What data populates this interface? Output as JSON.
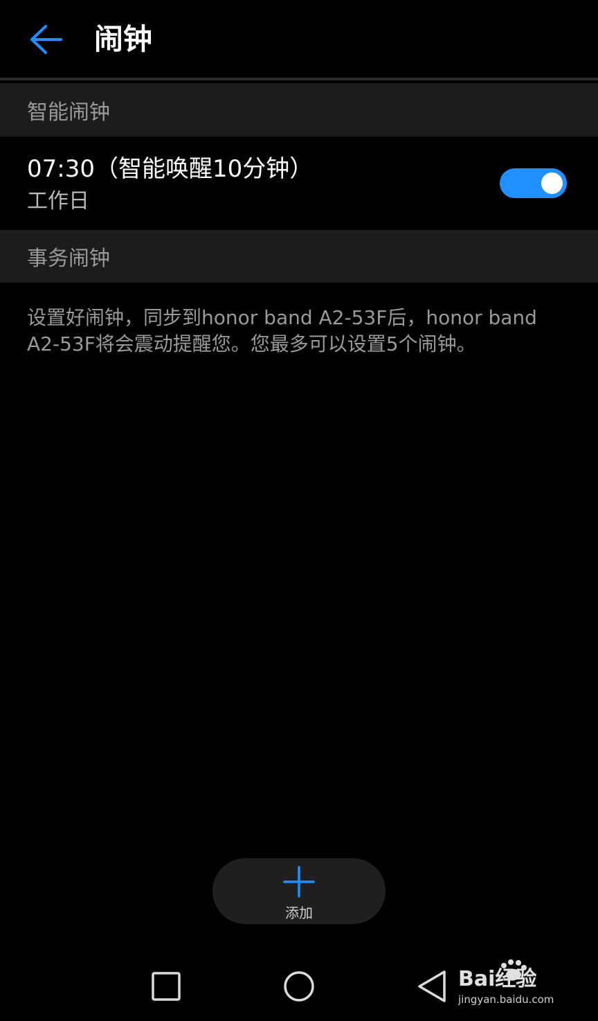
{
  "header": {
    "title": "闹钟",
    "back_icon": "arrow-left-icon",
    "accent_color": "#1e90ff"
  },
  "sections": {
    "smart_alarm": {
      "title": "智能闹钟",
      "alarm": {
        "time_label": "07:30（智能唤醒10分钟）",
        "repeat": "工作日",
        "enabled": true
      }
    },
    "task_alarm": {
      "title": "事务闹钟",
      "description": "设置好闹钟，同步到honor band A2-53F后，honor band A2-53F将会震动提醒您。您最多可以设置5个闹钟。"
    }
  },
  "add_button": {
    "label": "添加",
    "icon": "plus-icon"
  },
  "navbar": {
    "recent_icon": "square-icon",
    "home_icon": "circle-icon",
    "back_icon": "triangle-back-icon"
  },
  "watermark": {
    "brand": "Bai经验",
    "url": "jingyan.baidu.com"
  }
}
